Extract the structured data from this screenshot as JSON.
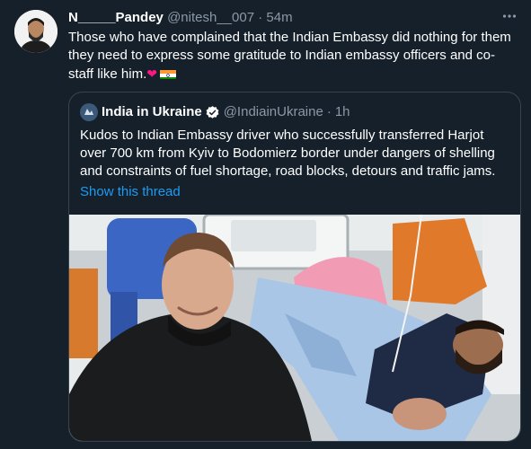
{
  "tweet": {
    "display_name": "N_____Pandey",
    "handle": "@nitesh__007",
    "separator": "·",
    "time": "54m",
    "more_icon": "more-horizontal-icon",
    "text": "Those who have complained that the Indian Embassy did nothing for them they need to express some gratitude to Indian embassy officers and co-staff like him.",
    "emoji_heart": "❤"
  },
  "quote": {
    "display_name": "India in Ukraine",
    "handle": "@IndiainUkraine",
    "separator": "·",
    "time": "1h",
    "text": "Kudos to Indian Embassy driver who successfully transferred Harjot over 700 km from Kyiv to Bodomierz border under dangers of shelling and constraints of fuel shortage, road blocks, detours and traffic jams.",
    "show_thread": "Show this thread"
  },
  "colors": {
    "background": "#15202b",
    "accent": "#1d9bf0",
    "muted": "#8b98a5",
    "border": "#38444d",
    "heart": "#f91880"
  }
}
